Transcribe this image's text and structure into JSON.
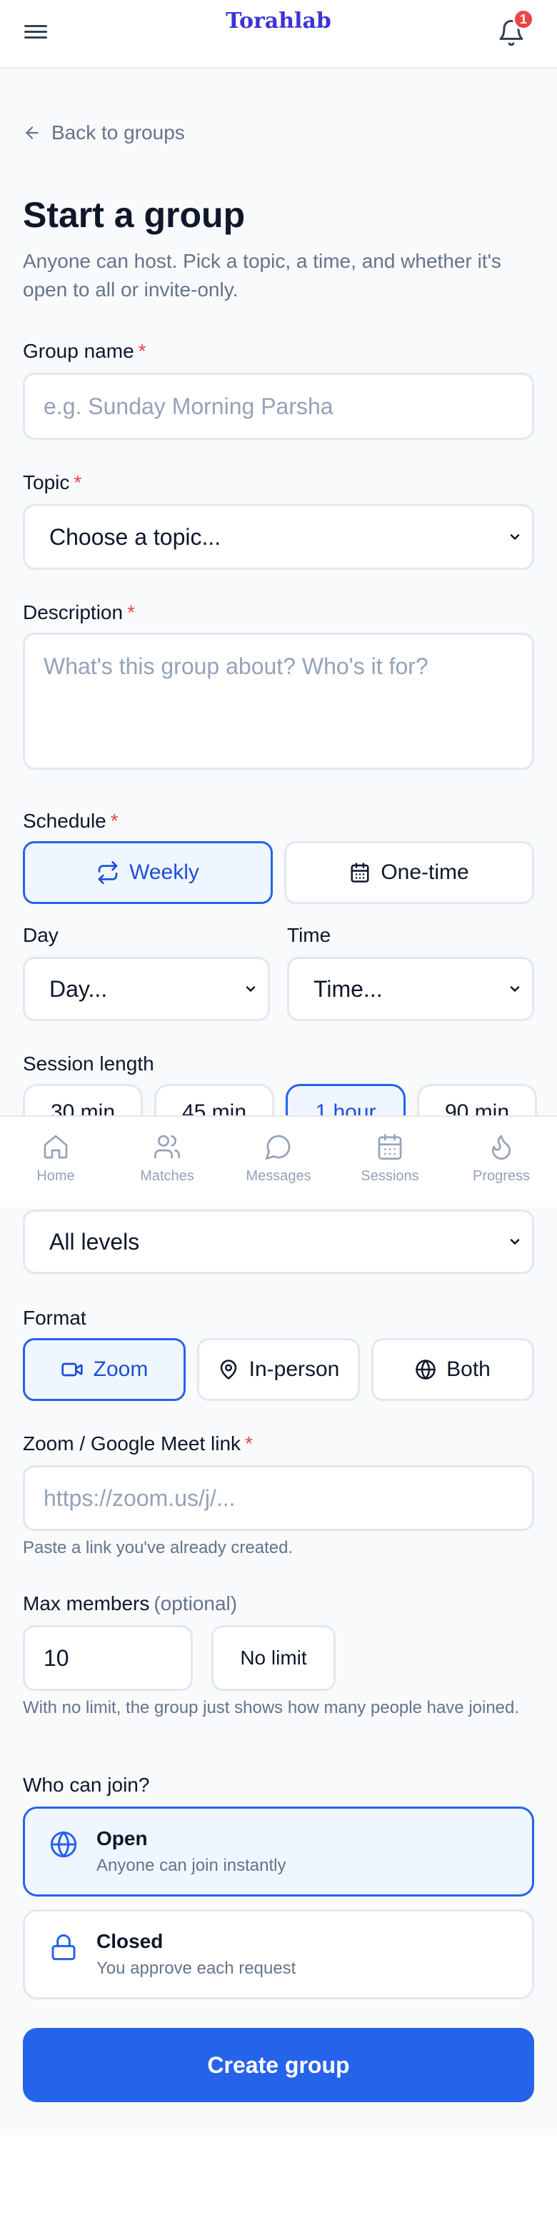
{
  "header": {
    "brand": "Torahlab",
    "notification_count": "1"
  },
  "back_link": "Back to groups",
  "page": {
    "title": "Start a group",
    "subtitle": "Anyone can host. Pick a topic, a time, and whether it's open to all or invite-only."
  },
  "group_name": {
    "label": "Group name",
    "required": "*",
    "placeholder": "e.g. Sunday Morning Parsha"
  },
  "topic": {
    "label": "Topic",
    "required": "*",
    "selected": "Choose a topic..."
  },
  "description": {
    "label": "Description",
    "required": "*",
    "placeholder": "What's this group about? Who's it for?"
  },
  "schedule": {
    "label": "Schedule",
    "required": "*",
    "weekly": "Weekly",
    "one_time": "One-time",
    "selected": "Weekly"
  },
  "day": {
    "label": "Day",
    "selected": "Day..."
  },
  "time": {
    "label": "Time",
    "selected": "Time..."
  },
  "session_length": {
    "label": "Session length",
    "options": [
      "30 min",
      "45 min",
      "1 hour",
      "90 min"
    ],
    "selected": "1 hour"
  },
  "tabbar": {
    "items": [
      "Home",
      "Matches",
      "Messages",
      "Sessions",
      "Progress"
    ]
  },
  "level": {
    "selected": "All levels"
  },
  "format": {
    "label": "Format",
    "options": [
      "Zoom",
      "In-person",
      "Both"
    ],
    "selected": "Zoom"
  },
  "zoom_link": {
    "label": "Zoom / Google Meet link",
    "required": "*",
    "placeholder": "https://zoom.us/j/...",
    "hint": "Paste a link you've already created."
  },
  "max_members": {
    "label": "Max members",
    "optional": "(optional)",
    "value": "10",
    "no_limit": "No limit",
    "hint": "With no limit, the group just shows how many people have joined."
  },
  "who_can_join": {
    "label": "Who can join?",
    "open_title": "Open",
    "open_sub": "Anyone can join instantly",
    "closed_title": "Closed",
    "closed_sub": "You approve each request",
    "selected": "Open"
  },
  "submit": "Create group",
  "colors": {
    "primary": "#2563eb",
    "brand": "#3b34d6",
    "required": "#ef4444",
    "active_bg": "#eff6ff"
  },
  "icons": [
    "menu-icon",
    "bell-icon",
    "arrow-left-icon",
    "repeat-icon",
    "calendar-icon",
    "chevron-down-icon",
    "home-icon",
    "users-icon",
    "message-icon",
    "calendar-icon",
    "flame-icon",
    "video-icon",
    "map-pin-icon",
    "globe-icon",
    "lock-icon"
  ]
}
